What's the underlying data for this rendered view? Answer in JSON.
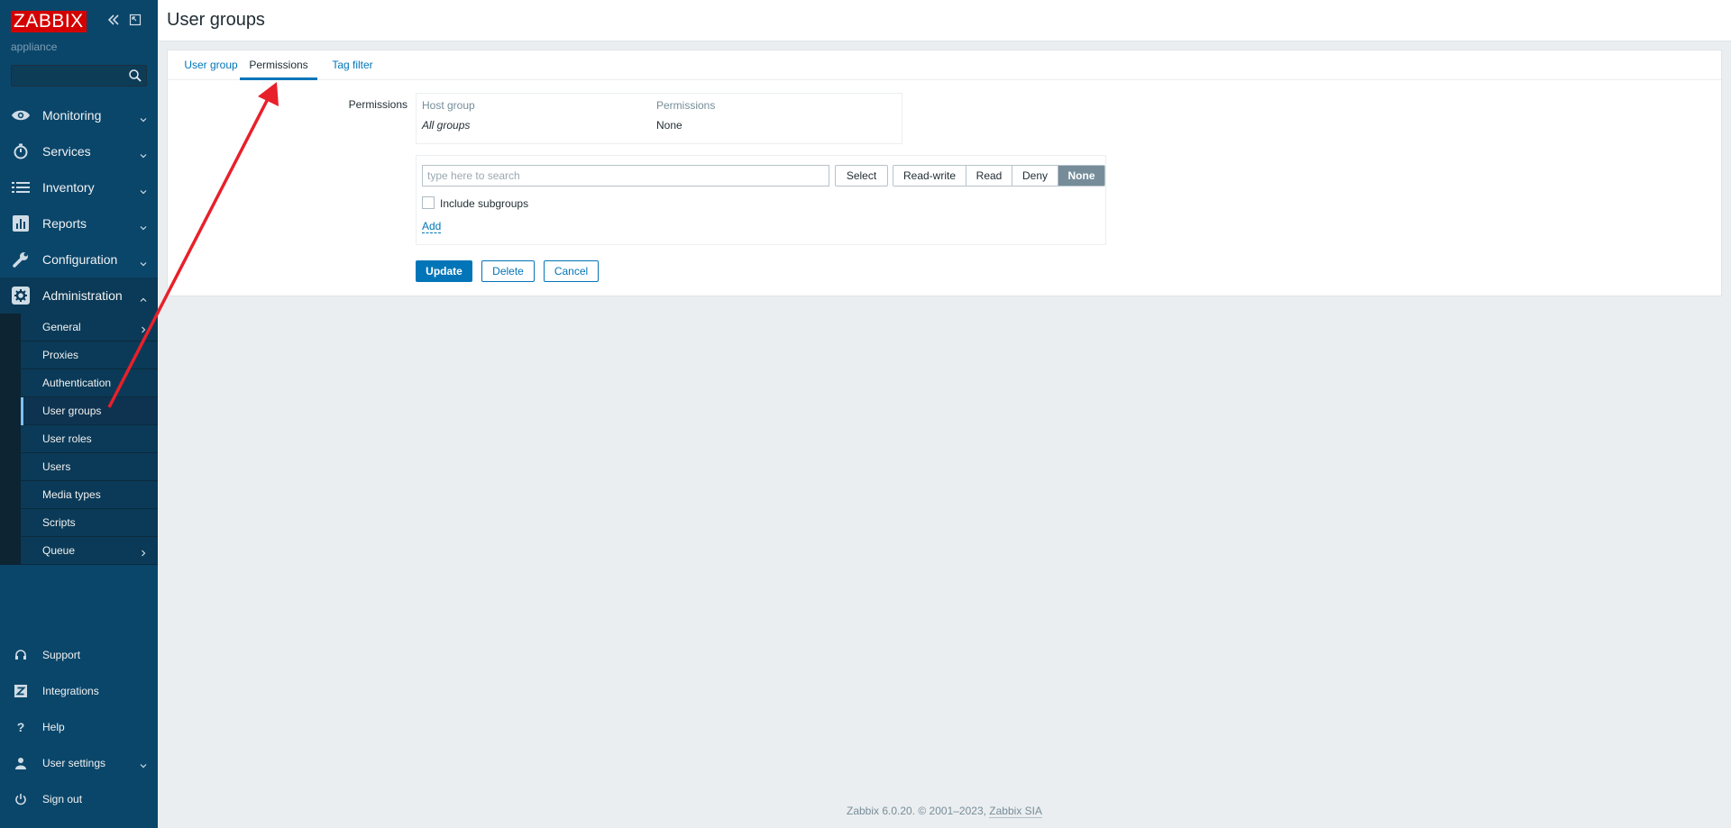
{
  "sidebar": {
    "logo": "ZABBIX",
    "server_name": "appliance",
    "search_placeholder": "",
    "menu": [
      {
        "label": "Monitoring",
        "icon": "eye-icon"
      },
      {
        "label": "Services",
        "icon": "stopwatch-icon"
      },
      {
        "label": "Inventory",
        "icon": "list-icon"
      },
      {
        "label": "Reports",
        "icon": "bar-chart-icon"
      },
      {
        "label": "Configuration",
        "icon": "wrench-icon"
      },
      {
        "label": "Administration",
        "icon": "gear-icon"
      }
    ],
    "admin_submenu": [
      {
        "label": "General"
      },
      {
        "label": "Proxies"
      },
      {
        "label": "Authentication"
      },
      {
        "label": "User groups"
      },
      {
        "label": "User roles"
      },
      {
        "label": "Users"
      },
      {
        "label": "Media types"
      },
      {
        "label": "Scripts"
      },
      {
        "label": "Queue"
      }
    ],
    "bottom_menu": [
      {
        "label": "Support",
        "icon": "headset-icon"
      },
      {
        "label": "Integrations",
        "icon": "zabbix-z-icon"
      },
      {
        "label": "Help",
        "icon": "question-icon"
      },
      {
        "label": "User settings",
        "icon": "user-icon"
      },
      {
        "label": "Sign out",
        "icon": "power-icon"
      }
    ]
  },
  "header": {
    "title": "User groups"
  },
  "tabs": [
    {
      "label": "User group"
    },
    {
      "label": "Permissions"
    },
    {
      "label": "Tag filter"
    }
  ],
  "permissions": {
    "field_label": "Permissions",
    "columns": [
      "Host group",
      "Permissions"
    ],
    "rows": [
      {
        "host_group": "All groups",
        "permission": "None"
      }
    ]
  },
  "add_form": {
    "search_placeholder": "type here to search",
    "select_label": "Select",
    "levels": [
      "Read-write",
      "Read",
      "Deny",
      "None"
    ],
    "selected_level": "None",
    "include_subgroups_label": "Include subgroups",
    "add_label": "Add"
  },
  "actions": {
    "update": "Update",
    "delete": "Delete",
    "cancel": "Cancel"
  },
  "footer": {
    "text": "Zabbix 6.0.20. © 2001–2023, ",
    "link": "Zabbix SIA"
  },
  "colors": {
    "sidebar": "#0a466a",
    "accent": "#0275b8",
    "logo_bg": "#d40000",
    "annotation_arrow": "#e8202a"
  }
}
